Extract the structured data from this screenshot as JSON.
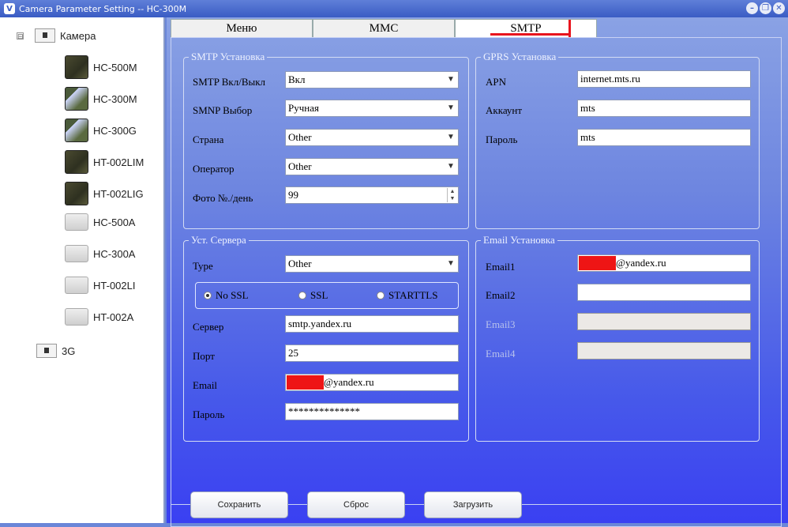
{
  "window": {
    "title": "Camera Parameter Setting -- HC-300M",
    "buttons": [
      "minimize",
      "restore",
      "close"
    ]
  },
  "sidebar": {
    "root": "Камера",
    "root_expander": "⊟",
    "cameras": [
      "HC-500M",
      "HC-300M",
      "HC-300G",
      "HT-002LIM",
      "HT-002LIG",
      "HC-500A",
      "HC-300A",
      "HT-002LI",
      "HT-002A"
    ],
    "group2": "3G"
  },
  "tabs": [
    {
      "label": "Меню"
    },
    {
      "label": "MMC"
    },
    {
      "label": "SMTP",
      "active": true
    }
  ],
  "smtp_setup": {
    "legend": "SMTP Установка",
    "smtp_onoff_label": "SMTP Вкл/Выкл",
    "smtp_onoff_value": "Вкл",
    "smnp_label": "SMNP Выбор",
    "smnp_value": "Ручная",
    "country_label": "Страна",
    "country_value": "Other",
    "operator_label": "Оператор",
    "operator_value": "Other",
    "photos_label": "Фото №./день",
    "photos_value": "99"
  },
  "gprs": {
    "legend": "GPRS Установка",
    "apn_label": "APN",
    "apn_value": "internet.mts.ru",
    "account_label": "Аккаунт",
    "account_value": "mts",
    "password_label": "Пароль",
    "password_value": "mts"
  },
  "server": {
    "legend": "Уст. Сервера",
    "type_label": "Type",
    "type_value": "Other",
    "ssl_options": [
      "No SSL",
      "SSL",
      "STARTTLS"
    ],
    "ssl_selected": "No SSL",
    "server_label": "Сервер",
    "server_value": "smtp.yandex.ru",
    "port_label": "Порт",
    "port_value": "25",
    "email_label": "Email",
    "email_domain": "@yandex.ru",
    "password_label": "Пароль",
    "password_value": "**************"
  },
  "email_setup": {
    "legend": "Email Установка",
    "email1_label": "Email1",
    "email1_domain": "@yandex.ru",
    "email2_label": "Email2",
    "email2_value": "",
    "email3_label": "Email3",
    "email4_label": "Email4"
  },
  "actions": {
    "save": "Сохранить",
    "reset": "Сброс",
    "load": "Загрузить"
  },
  "colors": {
    "accent": "#e8141e",
    "panel_top": "#8aa2e4",
    "panel_bottom": "#3a40f2",
    "title_bar": "#3a5cc4"
  }
}
